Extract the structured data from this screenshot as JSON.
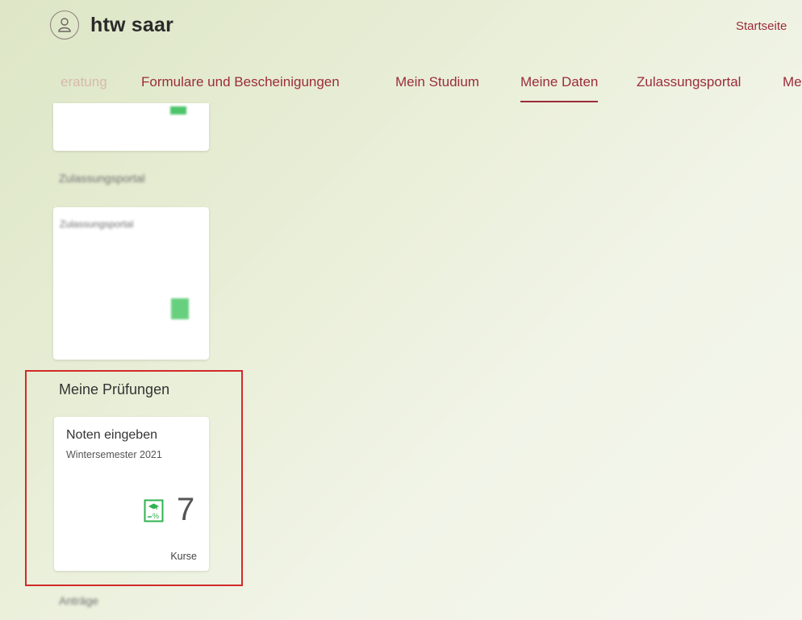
{
  "header": {
    "logo_text": "htw saar",
    "home_link": "Startseite"
  },
  "nav": {
    "tabs": [
      {
        "label": "eratung"
      },
      {
        "label": "Formulare und Bescheinigungen"
      },
      {
        "label": "Mein Studium"
      },
      {
        "label": "Meine Daten"
      },
      {
        "label": "Zulassungsportal"
      },
      {
        "label": "Me"
      }
    ],
    "active_tab": "Meine Daten"
  },
  "groups": {
    "zulassung_title": "Zulassungsportal",
    "zulassung_tile_title": "Zulassungsportal",
    "pruefungen_title": "Meine Prüfungen",
    "antraege_title": "Anträge"
  },
  "exam_tile": {
    "title": "Noten eingeben",
    "subtitle": "Wintersemester 2021",
    "icon": "grade-percent-icon",
    "count": "7",
    "unit": "Kurse"
  },
  "colors": {
    "accent": "#9b2c3a",
    "highlight": "#d12a2a",
    "icon_green": "#2fb350"
  }
}
